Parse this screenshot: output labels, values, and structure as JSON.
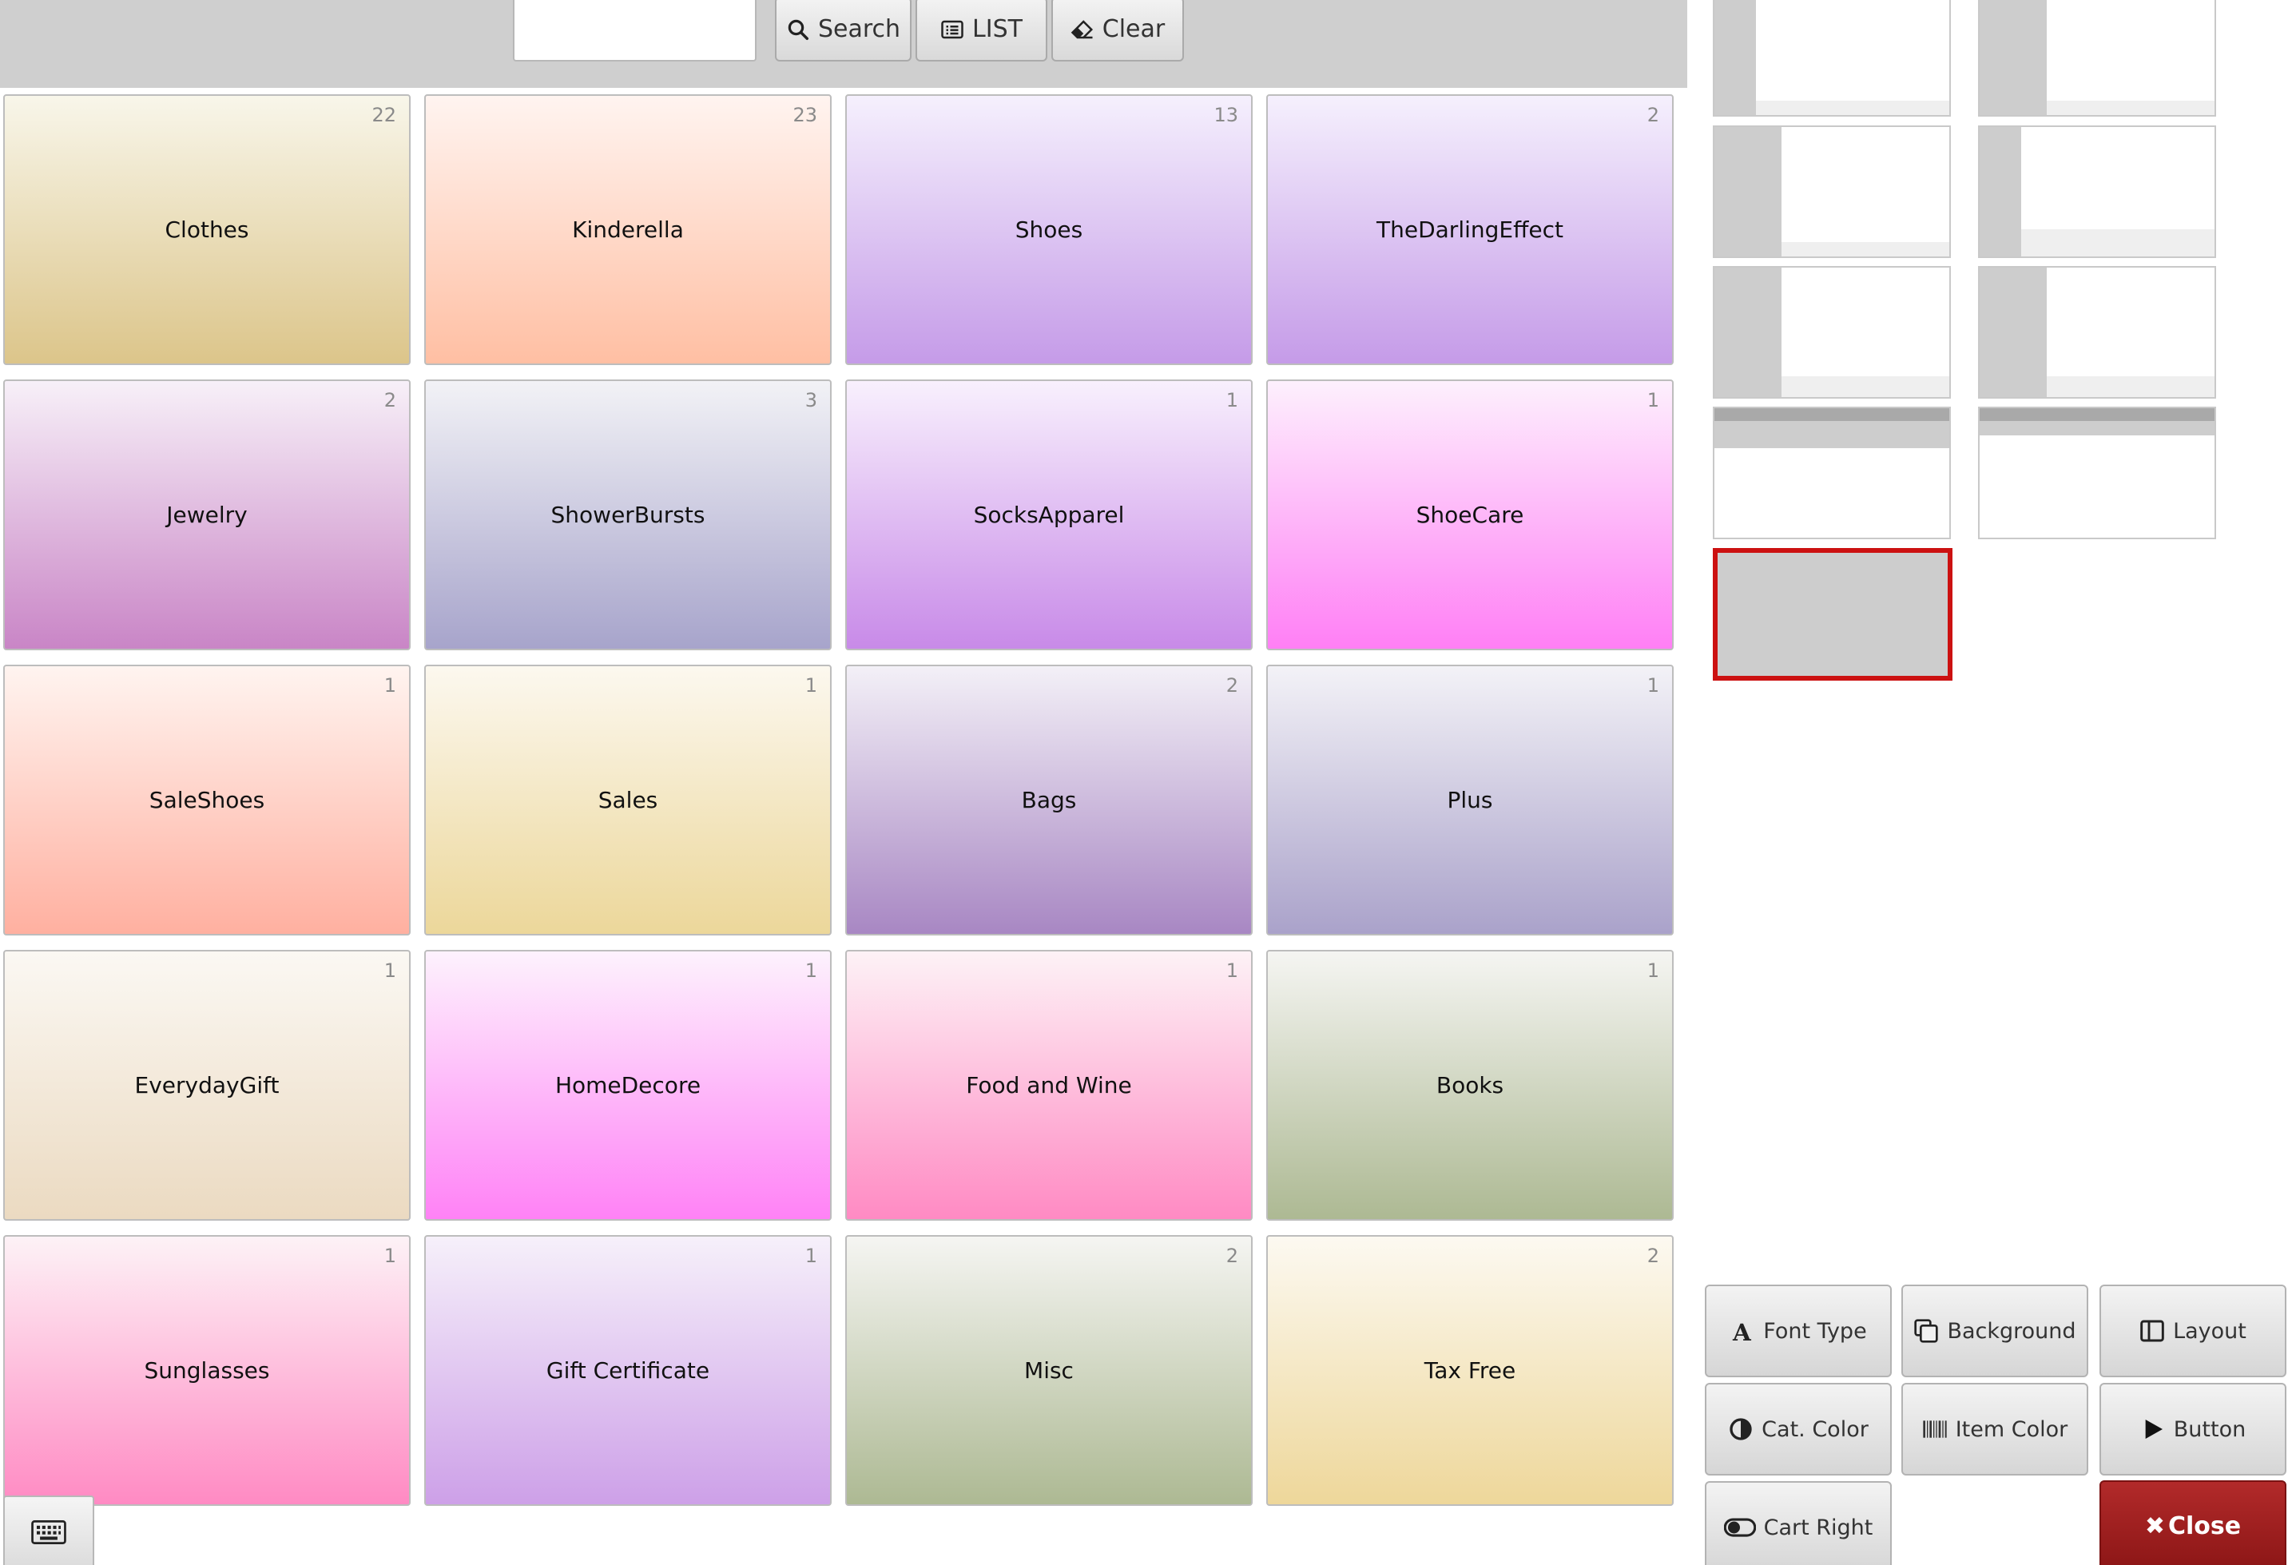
{
  "toolbar": {
    "search_value": "",
    "search_label": "Search",
    "list_label": "LIST",
    "clear_label": "Clear"
  },
  "categories": [
    {
      "name": "Clothes",
      "count": "22",
      "top": "#f8f6ea",
      "bottom": "#dcc58a"
    },
    {
      "name": "Kinderella",
      "count": "23",
      "top": "#fff4f0",
      "bottom": "#ffbfa3"
    },
    {
      "name": "Shoes",
      "count": "13",
      "top": "#f5f0fd",
      "bottom": "#c59be8"
    },
    {
      "name": "TheDarlingEffect",
      "count": "2",
      "top": "#f5f0fd",
      "bottom": "#c59be8"
    },
    {
      "name": "Jewelry",
      "count": "2",
      "top": "#f7f0f8",
      "bottom": "#c985c6"
    },
    {
      "name": "ShowerBursts",
      "count": "3",
      "top": "#f2f2f6",
      "bottom": "#a7a4cb"
    },
    {
      "name": "SocksApparel",
      "count": "1",
      "top": "#f8f0fd",
      "bottom": "#c88ae8"
    },
    {
      "name": "ShoeCare",
      "count": "1",
      "top": "#fdf0fd",
      "bottom": "#ff7ff5"
    },
    {
      "name": "SaleShoes",
      "count": "1",
      "top": "#fff4f0",
      "bottom": "#ffb0a0"
    },
    {
      "name": "Sales",
      "count": "1",
      "top": "#fcf8ef",
      "bottom": "#ecd79a"
    },
    {
      "name": "Bags",
      "count": "2",
      "top": "#f3f0f7",
      "bottom": "#a887c3"
    },
    {
      "name": "Plus",
      "count": "1",
      "top": "#f3f2f7",
      "bottom": "#aaa2ca"
    },
    {
      "name": "EverydayGift",
      "count": "1",
      "top": "#fbf8f3",
      "bottom": "#ebdac1"
    },
    {
      "name": "HomeDecore",
      "count": "1",
      "top": "#fdf2fd",
      "bottom": "#ff82f6"
    },
    {
      "name": "Food and Wine",
      "count": "1",
      "top": "#fdf2f6",
      "bottom": "#ff8ac3"
    },
    {
      "name": "Books",
      "count": "1",
      "top": "#f5f5f2",
      "bottom": "#adb993"
    },
    {
      "name": "Sunglasses",
      "count": "1",
      "top": "#fdf2f6",
      "bottom": "#ff8ac3"
    },
    {
      "name": "Gift Certificate",
      "count": "1",
      "top": "#f6f0fa",
      "bottom": "#cda0e8"
    },
    {
      "name": "Misc",
      "count": "2",
      "top": "#f5f5f2",
      "bottom": "#adb993"
    },
    {
      "name": "Tax Free",
      "count": "2",
      "top": "#fcf9f1",
      "bottom": "#eed79a"
    }
  ],
  "settings": {
    "font_type": "Font Type",
    "background": "Background",
    "layout": "Layout",
    "cat_color": "Cat. Color",
    "item_color": "Item Color",
    "button": "Button",
    "cart_right": "Cart Right",
    "close": "Close"
  },
  "colors": {
    "close_button": "#9e1f1f",
    "selected_outline": "#cc1111",
    "toolbar_bg": "#cfcfcf"
  }
}
